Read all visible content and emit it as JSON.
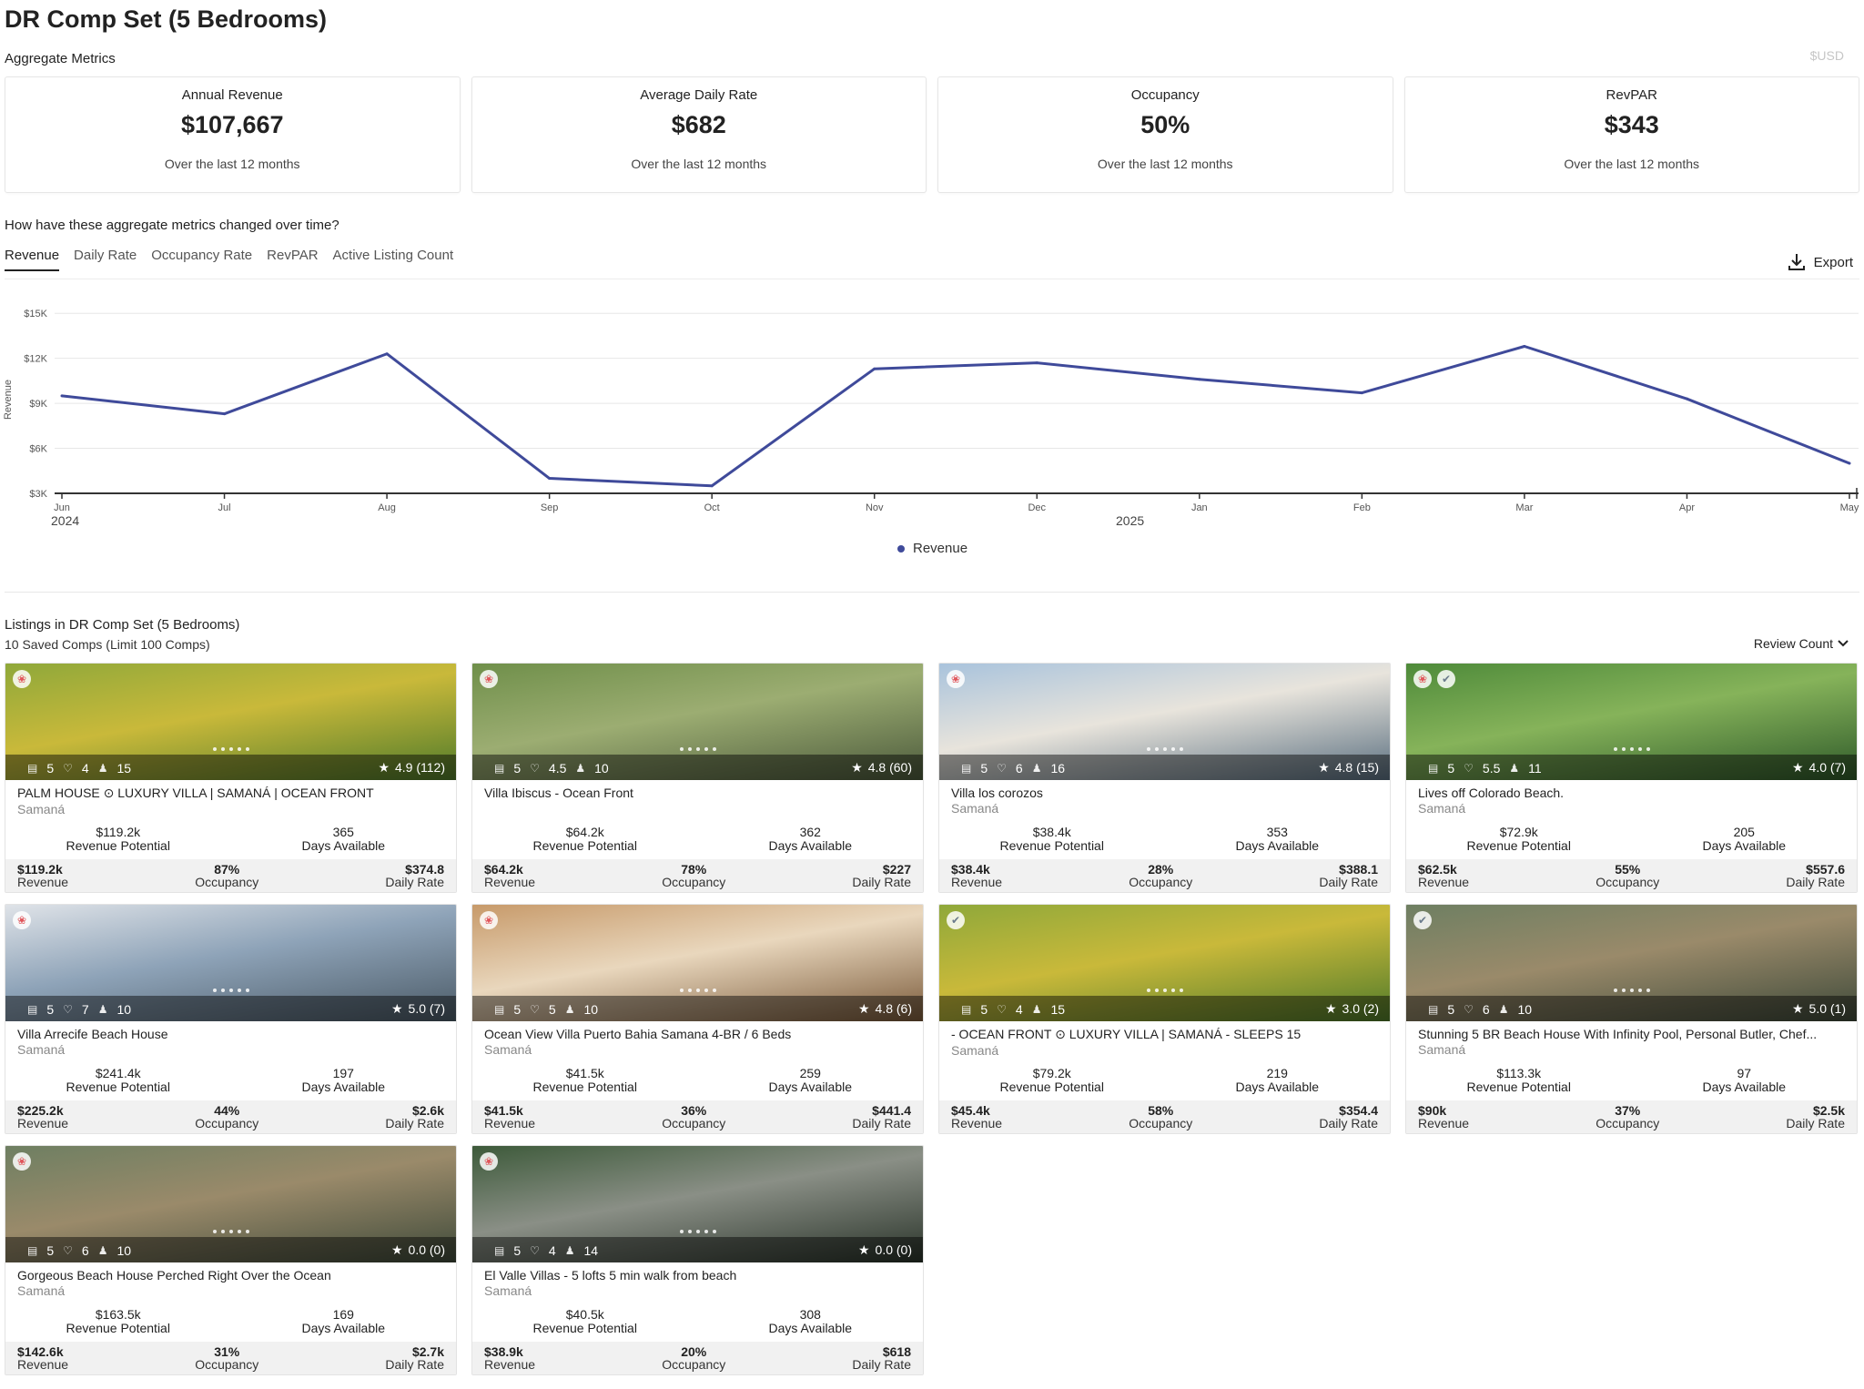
{
  "title": "DR Comp Set (5 Bedrooms)",
  "aggregate_label": "Aggregate Metrics",
  "currency": "$USD",
  "metrics": [
    {
      "title": "Annual Revenue",
      "value": "$107,667",
      "sub": "Over the last 12 months"
    },
    {
      "title": "Average Daily Rate",
      "value": "$682",
      "sub": "Over the last 12 months"
    },
    {
      "title": "Occupancy",
      "value": "50%",
      "sub": "Over the last 12 months"
    },
    {
      "title": "RevPAR",
      "value": "$343",
      "sub": "Over the last 12 months"
    }
  ],
  "question": "How have these aggregate metrics changed over time?",
  "tabs": [
    "Revenue",
    "Daily Rate",
    "Occupancy Rate",
    "RevPAR",
    "Active Listing Count"
  ],
  "active_tab": "Revenue",
  "export_label": "Export",
  "colors": {
    "line": "#3f4a9a",
    "grid": "#e7e7e7",
    "airbnb": "#e0565b"
  },
  "chart_data": {
    "type": "line",
    "x": [
      "Jun",
      "Jul",
      "Aug",
      "Sep",
      "Oct",
      "Nov",
      "Dec",
      "Jan",
      "Feb",
      "Mar",
      "Apr",
      "May"
    ],
    "year_labels": [
      "2024",
      "2025"
    ],
    "ylabel": "Revenue",
    "yticks": [
      "$3K",
      "$6K",
      "$9K",
      "$12K",
      "$15K"
    ],
    "ylim": [
      3000,
      15500
    ],
    "grid": true,
    "legend_position": "bottom-center",
    "series": [
      {
        "name": "Revenue",
        "values": [
          9500,
          8300,
          12300,
          4000,
          3500,
          11300,
          11700,
          10600,
          9700,
          12800,
          9300,
          5000
        ]
      }
    ]
  },
  "legend_label": "Revenue",
  "listings_title": "Listings in DR Comp Set (5 Bedrooms)",
  "listings_sub": "10 Saved Comps (Limit 100 Comps)",
  "sort_label": "Review Count",
  "labels": {
    "revenue_potential": "Revenue Potential",
    "days_available": "Days Available",
    "revenue": "Revenue",
    "occupancy": "Occupancy",
    "daily_rate": "Daily Rate"
  },
  "listings": [
    {
      "name": "PALM HOUSE ⊙ LUXURY VILLA | SAMANÁ | OCEAN FRONT",
      "location": "Samaná",
      "bedrooms": "5",
      "baths": "4",
      "guests": "15",
      "rating": "4.9 (112)",
      "revenue_potential": "$119.2k",
      "days_available": "365",
      "revenue": "$119.2k",
      "occupancy": "87%",
      "daily_rate": "$374.8",
      "badges": [
        "airbnb"
      ],
      "img": [
        "#8fa83a",
        "#c9b93a",
        "#4f7a2a"
      ]
    },
    {
      "name": "Villa Ibiscus - Ocean Front",
      "location": "",
      "bedrooms": "5",
      "baths": "4.5",
      "guests": "10",
      "rating": "4.8 (60)",
      "revenue_potential": "$64.2k",
      "days_available": "362",
      "revenue": "$64.2k",
      "occupancy": "78%",
      "daily_rate": "$227",
      "badges": [
        "airbnb"
      ],
      "img": [
        "#6f8f4a",
        "#9cad72",
        "#4c5a3c"
      ]
    },
    {
      "name": "Villa los corozos",
      "location": "Samaná",
      "bedrooms": "5",
      "baths": "6",
      "guests": "16",
      "rating": "4.8 (15)",
      "revenue_potential": "$38.4k",
      "days_available": "353",
      "revenue": "$38.4k",
      "occupancy": "28%",
      "daily_rate": "$388.1",
      "badges": [
        "airbnb"
      ],
      "img": [
        "#a9c3dc",
        "#e8e4dc",
        "#5a6f80"
      ]
    },
    {
      "name": "Lives off Colorado Beach.",
      "location": "Samaná",
      "bedrooms": "5",
      "baths": "5.5",
      "guests": "11",
      "rating": "4.0 (7)",
      "revenue_potential": "$72.9k",
      "days_available": "205",
      "revenue": "$62.5k",
      "occupancy": "55%",
      "daily_rate": "$557.6",
      "badges": [
        "airbnb",
        "vrbo"
      ],
      "img": [
        "#4e8a3a",
        "#86b35a",
        "#2f5a2a"
      ]
    },
    {
      "name": "Villa Arrecife Beach House",
      "location": "Samaná",
      "bedrooms": "5",
      "baths": "7",
      "guests": "10",
      "rating": "5.0 (7)",
      "revenue_potential": "$241.4k",
      "days_available": "197",
      "revenue": "$225.2k",
      "occupancy": "44%",
      "daily_rate": "$2.6k",
      "badges": [
        "airbnb"
      ],
      "img": [
        "#dfe3e8",
        "#8ea3b8",
        "#4b5a66"
      ]
    },
    {
      "name": "Ocean View Villa Puerto Bahia Samana 4-BR / 6 Beds",
      "location": "Samaná",
      "bedrooms": "5",
      "baths": "5",
      "guests": "10",
      "rating": "4.8 (6)",
      "revenue_potential": "$41.5k",
      "days_available": "259",
      "revenue": "$41.5k",
      "occupancy": "36%",
      "daily_rate": "$441.4",
      "badges": [
        "airbnb"
      ],
      "img": [
        "#c79a6a",
        "#e9d7bd",
        "#7a5a3a"
      ]
    },
    {
      "name": "- OCEAN FRONT ⊙ LUXURY VILLA | SAMANÁ - SLEEPS 15",
      "location": "Samaná",
      "bedrooms": "5",
      "baths": "4",
      "guests": "15",
      "rating": "3.0 (2)",
      "revenue_potential": "$79.2k",
      "days_available": "219",
      "revenue": "$45.4k",
      "occupancy": "58%",
      "daily_rate": "$354.4",
      "badges": [
        "vrbo"
      ],
      "img": [
        "#8fa83a",
        "#c9b93a",
        "#4f7a2a"
      ]
    },
    {
      "name": "Stunning 5 BR Beach House With Infinity Pool, Personal Butler, Chef...",
      "location": "Samaná",
      "bedrooms": "5",
      "baths": "6",
      "guests": "10",
      "rating": "5.0 (1)",
      "revenue_potential": "$113.3k",
      "days_available": "97",
      "revenue": "$90k",
      "occupancy": "37%",
      "daily_rate": "$2.5k",
      "badges": [
        "vrbo"
      ],
      "img": [
        "#6e7f62",
        "#9a8a6a",
        "#3f4a3a"
      ]
    },
    {
      "name": "Gorgeous Beach House Perched Right Over the Ocean",
      "location": "Samaná",
      "bedrooms": "5",
      "baths": "6",
      "guests": "10",
      "rating": "0.0 (0)",
      "revenue_potential": "$163.5k",
      "days_available": "169",
      "revenue": "$142.6k",
      "occupancy": "31%",
      "daily_rate": "$2.7k",
      "badges": [
        "airbnb"
      ],
      "img": [
        "#6e7f62",
        "#9a8a6a",
        "#3f4a3a"
      ]
    },
    {
      "name": "El Valle Villas - 5 lofts 5 min walk from beach",
      "location": "Samaná",
      "bedrooms": "5",
      "baths": "4",
      "guests": "14",
      "rating": "0.0 (0)",
      "revenue_potential": "$40.5k",
      "days_available": "308",
      "revenue": "$38.9k",
      "occupancy": "20%",
      "daily_rate": "$618",
      "badges": [
        "airbnb"
      ],
      "img": [
        "#3d5a3a",
        "#8a8f86",
        "#2a342a"
      ]
    }
  ]
}
